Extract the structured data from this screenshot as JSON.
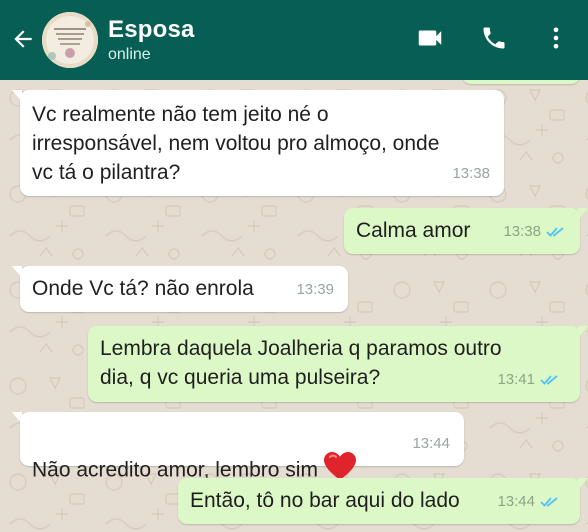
{
  "header": {
    "contact_name": "Esposa",
    "status": "online",
    "bg_color": "#075e54",
    "icons": [
      "back-arrow-icon",
      "video-call-icon",
      "phone-icon",
      "more-vert-icon"
    ]
  },
  "messages": [
    {
      "direction": "in",
      "text": "Vc realmente não tem jeito né o\nirresponsável, nem voltou pro almoço, onde\nvc tá o pilantra?",
      "time": "13:38"
    },
    {
      "direction": "out",
      "text": "Calma amor",
      "time": "13:38",
      "read": true
    },
    {
      "direction": "in",
      "text": "Onde Vc tá? não enrola",
      "time": "13:39"
    },
    {
      "direction": "out",
      "text": "Lembra daquela Joalheria q paramos outro\ndia, q vc queria uma pulseira?",
      "time": "13:41",
      "read": true
    },
    {
      "direction": "in",
      "text": "Não acredito amor,  lembro sim",
      "emoji": "red-heart",
      "time": "13:44"
    },
    {
      "direction": "out",
      "text": "Então, tô no bar aqui do lado",
      "time": "13:44",
      "read": true
    }
  ],
  "colors": {
    "incoming_bubble": "#ffffff",
    "outgoing_bubble": "#dcf8c6",
    "read_check": "#4fc3f7",
    "chat_bg": "#e5ddd1"
  }
}
